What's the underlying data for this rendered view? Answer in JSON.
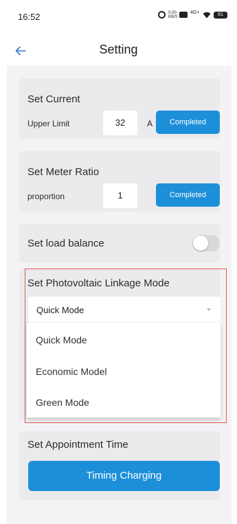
{
  "status_bar": {
    "time": "16:52",
    "speed": "0.00 KB/S",
    "network": "4G+",
    "battery": "61"
  },
  "header": {
    "title": "Setting",
    "back_icon": "arrow-left-icon"
  },
  "set_current": {
    "title": "Set Current",
    "label": "Upper Limit",
    "value": "32",
    "unit": "A",
    "button": "Completed"
  },
  "set_meter_ratio": {
    "title": "Set Meter Ratio",
    "label": "proportion",
    "value": "1",
    "button": "Completed"
  },
  "load_balance": {
    "title": "Set load balance",
    "enabled": false
  },
  "pv_linkage": {
    "title": "Set Photovoltaic Linkage Mode",
    "selected": "Quick Mode",
    "options": [
      "Quick Mode",
      "Economic Model",
      "Green Mode"
    ]
  },
  "appointment": {
    "title": "Set Appointment Time",
    "button": "Timing Charging"
  },
  "colors": {
    "primary": "#1d8fd8",
    "highlight": "#e4574c",
    "card": "#ebebee",
    "background": "#f3f3f6"
  }
}
